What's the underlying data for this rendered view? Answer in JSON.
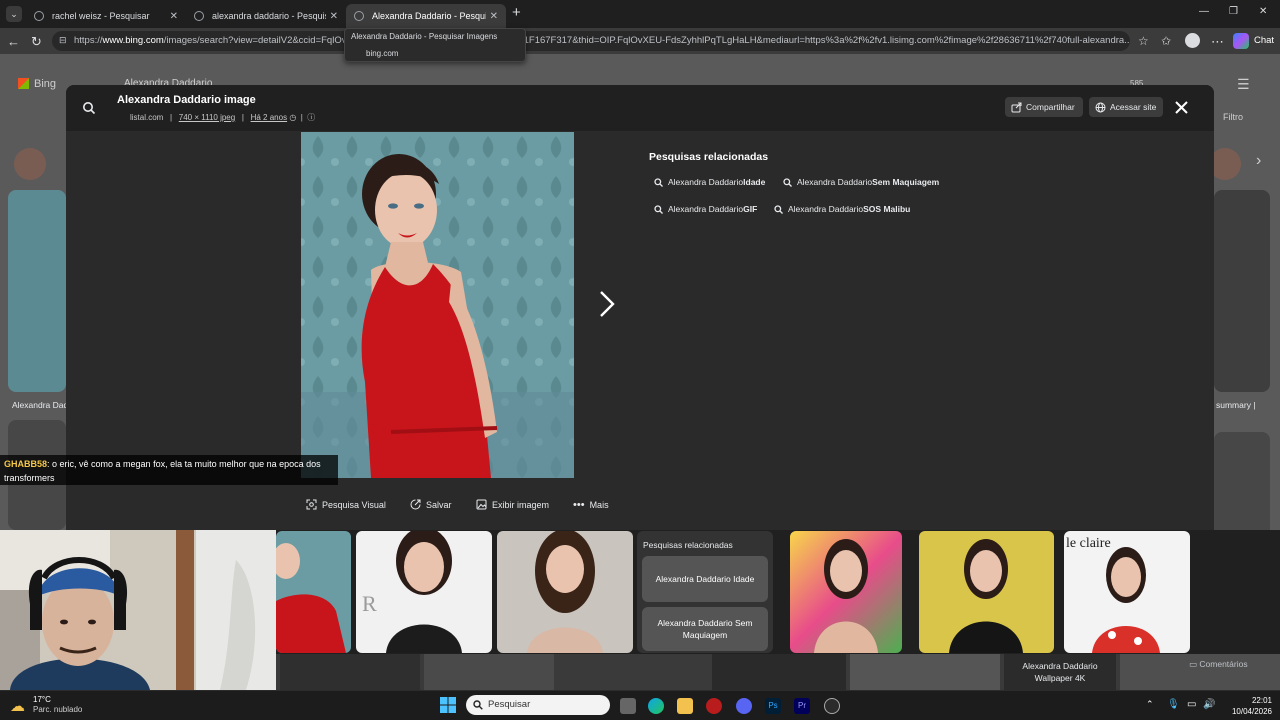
{
  "tabs": [
    {
      "label": "rachel weisz - Pesquisar",
      "active": false
    },
    {
      "label": "alexandra daddario - Pesquisar",
      "active": false
    },
    {
      "label": "Alexandra Daddario - Pesquisar Im",
      "active": true
    }
  ],
  "tooltip": {
    "title": "Alexandra Daddario - Pesquisar Imagens",
    "domain": "bing.com"
  },
  "address": {
    "prefix": "https://",
    "host": "www.bing.com",
    "rest": "/images/search?view=detailV2&ccid=FqlOvXEU-FdsZyhhlPqTLgHaLH&id=…F25B8A1F167F317&thid=OIP.FqlOvXEU-FdsZyhhlPqTLgHaLH&mediaurl=https%3a%2f%2fv1.lisimg.com%2fimage%2f28636711%2f740full-alexandra..."
  },
  "browser_right": {
    "chat_label": "Chat"
  },
  "bg_page": {
    "brand": "Bing",
    "search_value": "Alexandra Daddario",
    "filter_label": "Filtro",
    "left_caption": "Alexandra Dad",
    "right_caption": "summary |",
    "count": "585"
  },
  "viewer": {
    "title": "Alexandra Daddario image",
    "source": "listal.com",
    "dims": "740 × 1110 jpeg",
    "age": "Há 2 anos",
    "share_label": "Compartilhar",
    "visit_label": "Acessar site",
    "related_title": "Pesquisas relacionadas",
    "related": [
      {
        "base": "Alexandra Daddario ",
        "bold": "Idade"
      },
      {
        "base": "Alexandra Daddario ",
        "bold": "Sem Maquiagem"
      },
      {
        "base": "Alexandra Daddario ",
        "bold": "GIF"
      },
      {
        "base": "Alexandra Daddario ",
        "bold": "SOS Malibu"
      }
    ],
    "actions": [
      {
        "label": "Pesquisa Visual",
        "icon": "visual-search-icon"
      },
      {
        "label": "Salvar",
        "icon": "save-icon"
      },
      {
        "label": "Exibir imagem",
        "icon": "image-icon"
      },
      {
        "label": "Mais",
        "icon": "more-icon"
      }
    ]
  },
  "chat_overlay": {
    "user": "GHABB58",
    "message": ": o eric, vê como a megan fox, ela ta muito melhor que na epoca dos transformers"
  },
  "strip": {
    "related_card_title": "Pesquisas relacionadas",
    "related_chips": [
      "Alexandra Daddario Idade",
      "Alexandra Daddario Sem Maquiagem"
    ],
    "wallpaper_label": "Alexandra Daddario Wallpaper 4K",
    "comments_label": "Comentários"
  },
  "taskbar": {
    "weather_temp": "17°C",
    "weather_desc": "Parc. nublado",
    "search_placeholder": "Pesquisar",
    "time": "22:01",
    "date": "10/04/2026"
  },
  "colors": {
    "accent_red": "#c8151b",
    "wallpaper_teal": "#6f9fa6",
    "dark_overlay": "#2a2a2a"
  }
}
